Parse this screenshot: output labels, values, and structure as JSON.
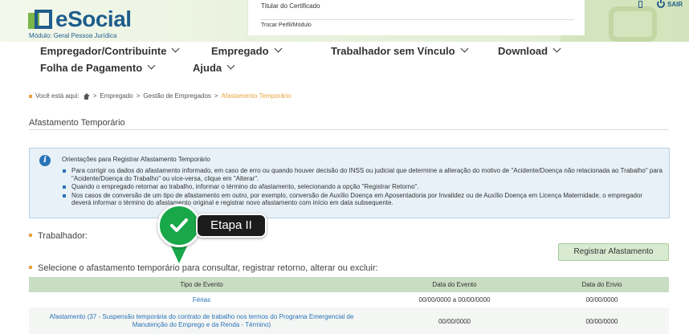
{
  "header": {
    "logo_text": "eSocial",
    "module_label": "Módulo: Geral Pessoa Jurídica",
    "certificate_label": "Titular do Certificado",
    "change_profile_label": "Trocar Perfil/Módulo",
    "exit_label": "SAIR"
  },
  "nav": {
    "items": [
      {
        "label": "Empregador/Contribuinte"
      },
      {
        "label": "Empregado"
      },
      {
        "label": "Trabalhador sem Vínculo"
      },
      {
        "label": "Download"
      },
      {
        "label": "Folha de Pagamento"
      },
      {
        "label": "Ajuda"
      }
    ]
  },
  "breadcrumb": {
    "prefix": "Você está aqui:",
    "items": [
      "Empregado",
      "Gestão de Empregados"
    ],
    "current": "Afastamento Temporário",
    "separator": ">"
  },
  "page": {
    "title": "Afastamento Temporário"
  },
  "info": {
    "title": "Orientações para Registrar Afastamento Temporário",
    "items": [
      "Para corrigir os dados do afastamento informado, em caso de erro ou quando houver decisão do INSS ou judicial que determine a alteração do motivo de \"Acidente/Doença não relacionada ao Trabalho\" para \"Acidente/Doença do Trabalho\" ou vice-versa, clique em \"Alterar\".",
      "Quando o empregado retornar ao trabalho, informar o término do afastamento, selecionando a opção \"Registrar Retorno\".",
      "Nos casos de conversão de um tipo de afastamento em outro, por exemplo, conversão de Auxílio Doença em Aposentadoria por Invalidez ou de Auxílio Doença em Licença Maternidade, o empregador deverá informar o término do afastamento original e registrar novo afastamento com início em data subsequente."
    ]
  },
  "worker_section": {
    "label": "Trabalhador:"
  },
  "register_button": {
    "label": "Registrar Afastamento"
  },
  "select_section": {
    "label": "Selecione o afastamento temporário para consultar, registrar retorno, alterar ou excluir:"
  },
  "table": {
    "headers": [
      "Tipo de Evento",
      "Data do Evento",
      "Data do Envio"
    ],
    "rows": [
      {
        "type": "Férias",
        "event_date": "00/00/0000 a 00/00/0000",
        "send_date": "00/00/0000"
      },
      {
        "type": "Afastamento (37 - Suspensão temporária do contrato de trabalho nos termos do Programa Emergencial de Manutenção do Emprego e da Renda - Término)",
        "event_date": "00/00/0000",
        "send_date": "00/00/0000"
      }
    ]
  },
  "annotation": {
    "step_label": "Etapa II",
    "icon": "check-icon"
  },
  "colors": {
    "brand_blue": "#1f5d8c",
    "brand_green": "#7ab648",
    "accent_orange": "#e8a33c",
    "badge_green": "#18a84a",
    "table_header": "#c9ddc2"
  }
}
